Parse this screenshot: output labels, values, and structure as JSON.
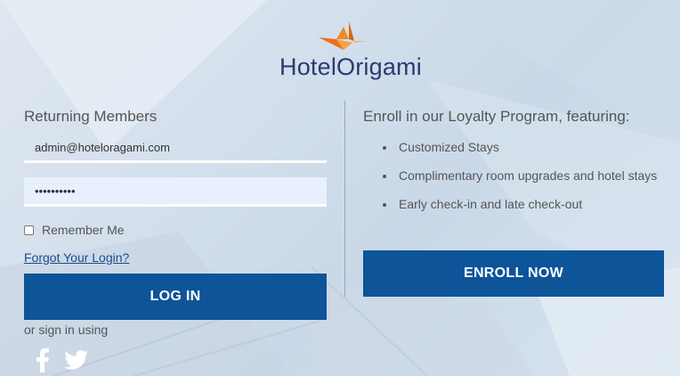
{
  "brand": {
    "name_part1": "Hotel",
    "name_part2": "Origami",
    "logo_icon": "origami-bird-icon",
    "accent_color": "#f08a24",
    "text_color": "#2a3b73"
  },
  "login": {
    "title": "Returning Members",
    "email_value": "admin@hoteloragami.com",
    "password_value": "••••••••••",
    "remember_label": "Remember Me",
    "forgot_label": "Forgot Your Login?",
    "login_button": "LOG IN",
    "social_label": "or sign in using",
    "social_icons": [
      "facebook-icon",
      "twitter-icon"
    ]
  },
  "enroll": {
    "title": "Enroll in our Loyalty Program, featuring:",
    "benefits": [
      "Customized Stays",
      "Complimentary room upgrades and hotel stays",
      "Early check-in and late check-out"
    ],
    "button": "ENROLL NOW"
  },
  "colors": {
    "button_bg": "#0d5499",
    "link": "#1a4e8f"
  }
}
